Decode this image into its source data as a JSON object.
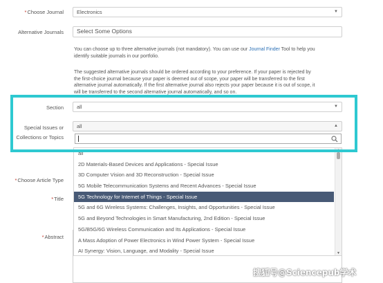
{
  "choose_journal": {
    "label": "Choose Journal",
    "value": "Electronics"
  },
  "alt_journals": {
    "label": "Alternative Journals",
    "placeholder": "Select Some Options"
  },
  "info1": {
    "line1_before": "You can choose up to three alternative journals (not mandatory). You can use our ",
    "link": "Journal Finder",
    "line1_after": " Tool to help you",
    "line2": "identify suitable journals in our portfolio."
  },
  "info2": {
    "line1": "The suggested alternative journals should be ordered according to your preference. If your paper is rejected by",
    "line2": "the first-choice journal because your paper is deemed out of scope, your paper will be transferred to the first",
    "line3": "alternative journal automatically. If the first alternative journal also rejects your paper because it is out of scope, it",
    "line4": "will be transferred to the second alternative journal automatically, and so on."
  },
  "section": {
    "label": "Section",
    "value": "all"
  },
  "special_issues": {
    "label_line1": "Special Issues or",
    "label_line2": "Collections or Topics",
    "value": "all",
    "search_value": ""
  },
  "article_type": {
    "label": "Choose Article Type"
  },
  "title_field": {
    "label": "Title"
  },
  "abstract_field": {
    "label": "Abstract"
  },
  "dropdown_items": [
    {
      "text": "all"
    },
    {
      "text": "2D Materials-Based Devices and Applications - Special Issue"
    },
    {
      "text": "3D Computer Vision and 3D Reconstruction - Special Issue"
    },
    {
      "text": "5G Mobile Telecommunication Systems and Recent Advances - Special Issue"
    },
    {
      "text": "5G Technology for Internet of Things - Special Issue"
    },
    {
      "text": "5G and 6G Wireless Systems: Challenges, Insights, and Opportunities - Special Issue"
    },
    {
      "text": "5G and Beyond Technologies in Smart Manufacturing, 2nd Edition - Special Issue"
    },
    {
      "text": "5G/B5G/6G Wireless Communication and Its Applications - Special Issue"
    },
    {
      "text": "A Mass Adoption of Power Electronics in Wind Power System - Special Issue"
    },
    {
      "text": "AI Synergy: Vision, Language, and Modality - Special Issue"
    }
  ],
  "selected_index": 4,
  "required_mark": "*",
  "watermark": "搜狐号@Sciencepub学术",
  "colors": {
    "highlight": "#2ec9d1",
    "selected_bg": "#485a76",
    "link": "#2a6fb5"
  }
}
